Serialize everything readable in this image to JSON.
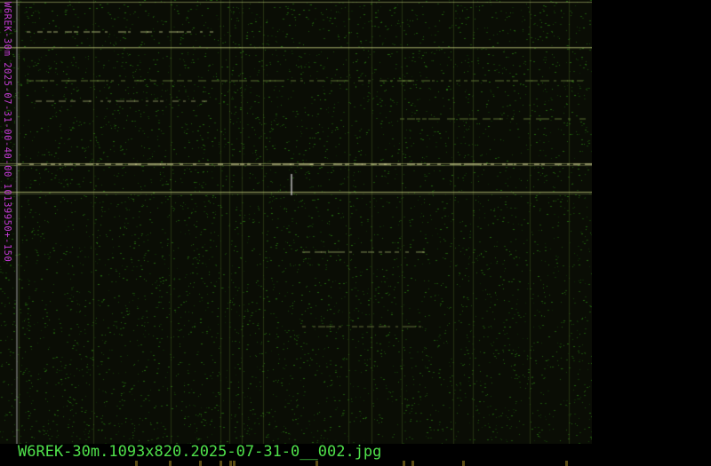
{
  "image": {
    "station_label": "W6REK-30m 2025-07-31-00-40-00 10139950+-150",
    "filename": "W6REK-30m.1093x820.2025-07-31-0__002.jpg"
  },
  "colors": {
    "background": "#000000",
    "noise": "#1a3a12",
    "signal": "#b8c878",
    "label_magenta": "#c43ad6",
    "filename_green": "#4fe04a"
  }
}
